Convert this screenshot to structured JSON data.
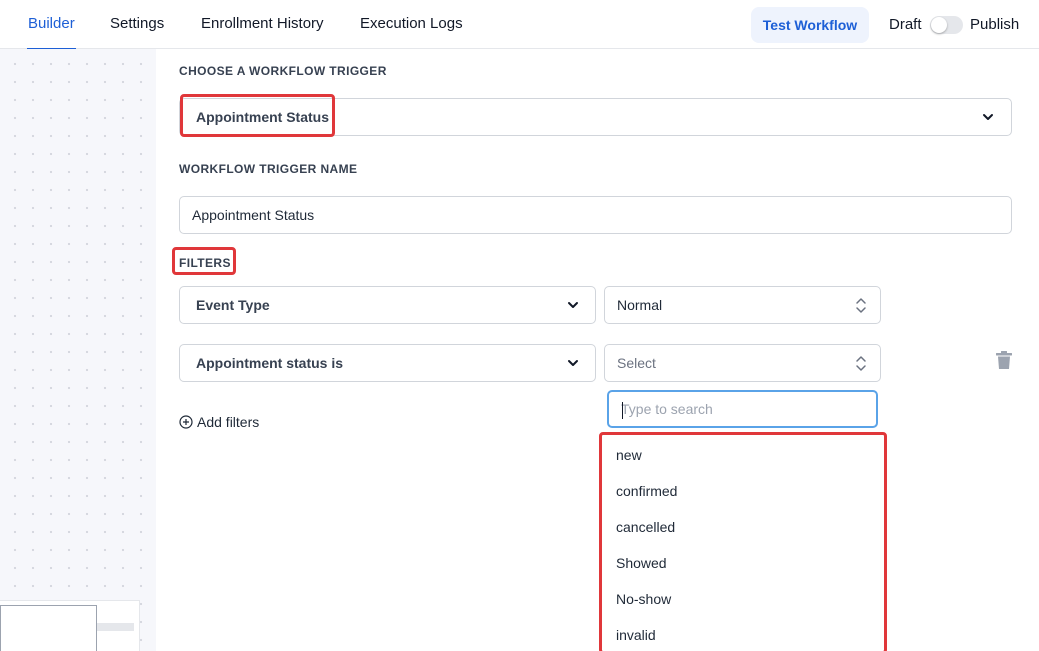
{
  "tabs": [
    {
      "label": "Builder",
      "active": true
    },
    {
      "label": "Settings"
    },
    {
      "label": "Enrollment History"
    },
    {
      "label": "Execution Logs"
    }
  ],
  "header": {
    "test_workflow": "Test Workflow",
    "draft": "Draft",
    "publish": "Publish",
    "publish_enabled": false
  },
  "trigger": {
    "section_label": "CHOOSE A WORKFLOW TRIGGER",
    "selected": "Appointment Status"
  },
  "trigger_name": {
    "section_label": "WORKFLOW TRIGGER NAME",
    "value": "Appointment Status"
  },
  "filters": {
    "section_label": "FILTERS",
    "rows": [
      {
        "field": "Event Type",
        "value": "Normal"
      },
      {
        "field": "Appointment status is",
        "value_placeholder": "Select"
      }
    ],
    "add_label": "Add filters"
  },
  "dropdown": {
    "search_placeholder": "Type to search",
    "options": [
      "new",
      "confirmed",
      "cancelled",
      "Showed",
      "No-show",
      "invalid"
    ]
  },
  "colors": {
    "accent": "#1d5fd6",
    "highlight": "#e0373a",
    "focus": "#5aa3e8"
  },
  "icons": [
    "chevron-down-icon",
    "up-down-arrows-icon",
    "trash-icon",
    "plus-circle-icon"
  ]
}
